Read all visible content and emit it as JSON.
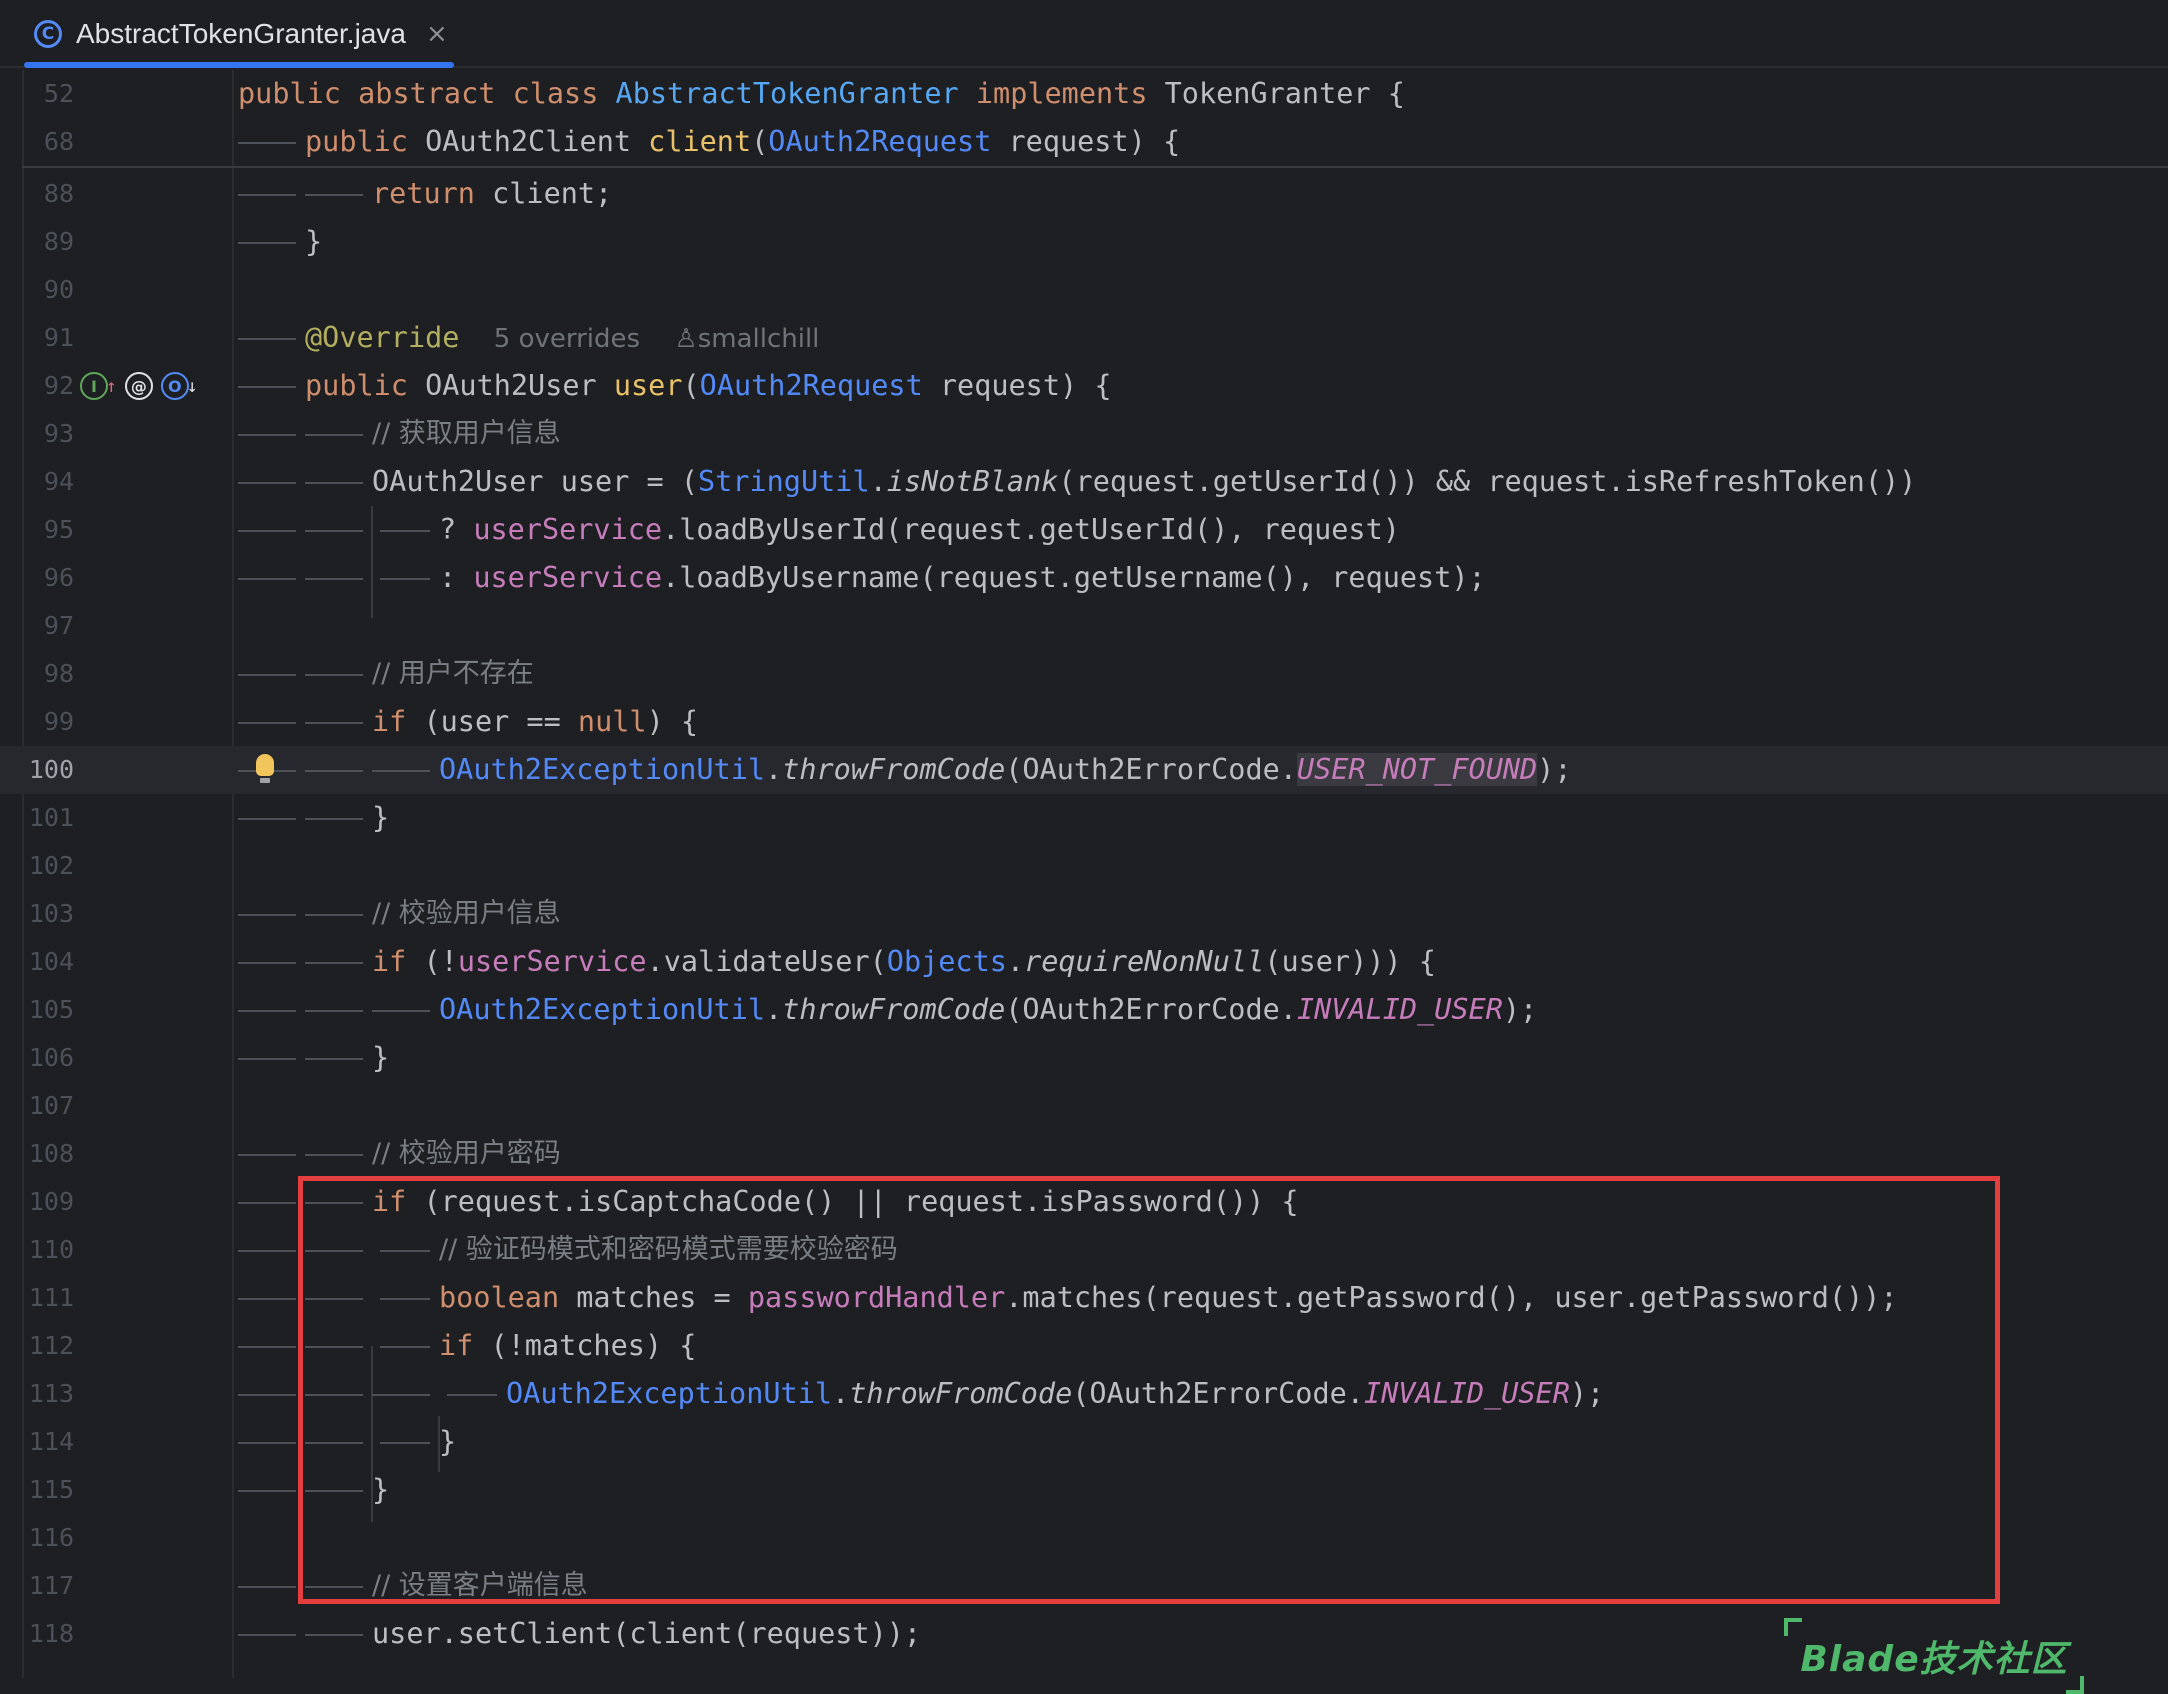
{
  "tab": {
    "icon": "class-icon",
    "title": "AbstractTokenGranter.java",
    "close": "×"
  },
  "inlay": {
    "overrides": "5 overrides",
    "author": "smallchill"
  },
  "watermark": "Blade技术社区",
  "colors": {
    "keyword": "#cf8e6d",
    "class_ref": "#56a8f5",
    "field": "#c77dbb",
    "comment": "#7a7e85",
    "annotation": "#b3ae60",
    "highlight_box": "#e53e3e"
  },
  "lines": {
    "l52": "52",
    "l68": "68",
    "l88": "88",
    "l89": "89",
    "l90": "90",
    "l91": "91",
    "l92": "92",
    "l93": "93",
    "l94": "94",
    "l95": "95",
    "l96": "96",
    "l97": "97",
    "l98": "98",
    "l99": "99",
    "l100": "100",
    "l101": "101",
    "l102": "102",
    "l103": "103",
    "l104": "104",
    "l105": "105",
    "l106": "106",
    "l107": "107",
    "l108": "108",
    "l109": "109",
    "l110": "110",
    "l111": "111",
    "l112": "112",
    "l113": "113",
    "l114": "114",
    "l115": "115",
    "l116": "116",
    "l117": "117",
    "l118": "118"
  },
  "comments": {
    "c93": "// 获取用户信息",
    "c98": "// 用户不存在",
    "c103": "// 校验用户信息",
    "c108": "// 校验用户密码",
    "c110": "// 验证码模式和密码模式需要校验密码",
    "c117": "// 设置客户端信息"
  }
}
